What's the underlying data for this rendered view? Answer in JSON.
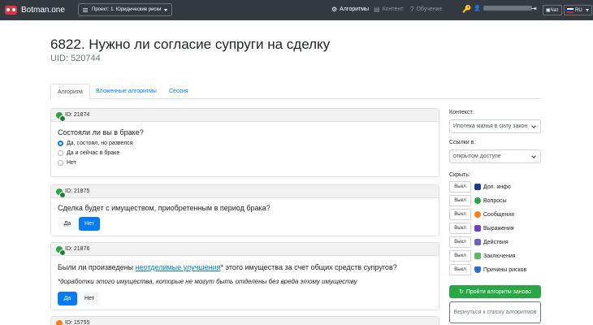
{
  "navbar": {
    "brand": "Botman.one",
    "project": "Проект: 1. Юридические риски",
    "algorithms": "Алгоритмы",
    "content": "Контент",
    "learning": "Обучение",
    "chat": "Чат",
    "lang": "RU"
  },
  "page": {
    "title": "6822. Нужно ли согласие супруги на сделку",
    "uid": "UID: 520744"
  },
  "tabs": [
    "Алгоритм",
    "Вложенные алгоритмы",
    "Сессия"
  ],
  "cards": [
    {
      "id": "ID: 21874",
      "question": "Состояли ли вы в браке?",
      "options": [
        "Да, состоял, но развелся",
        "Да и сейчас в браке",
        "Нет"
      ]
    },
    {
      "id": "ID: 21875",
      "question": "Сделка будет с имуществом, приобретенным в период брака?",
      "buttons": [
        "Да",
        "Нет"
      ]
    },
    {
      "id": "ID: 21876",
      "question_pre": "Были ли произведены ",
      "question_link": "неотделимые улучшения",
      "question_post": "* этого имущества за счет общих средств супругов?",
      "note": "*доработки этого имущества, которые не могут быть отделены без вреда этому имуществу",
      "buttons": [
        "Да",
        "Нет"
      ]
    },
    {
      "id": "ID: 15755"
    }
  ],
  "sidebar": {
    "context_label": "Контекст:",
    "context_value": "Ипотека жилья в силу закон",
    "links_label": "Ссылки в:",
    "links_value": "открытом доступе",
    "hide_label": "Скрыть:",
    "hide_button": "Выкл",
    "hide_items": [
      {
        "label": "Доп. инфо",
        "color": "#1a3f8f"
      },
      {
        "label": "Вопросы",
        "color": "#28a745"
      },
      {
        "label": "Сообщения",
        "color": "#fd7e14"
      },
      {
        "label": "Выражения",
        "color": "#6f42c1"
      },
      {
        "label": "Действия",
        "color": "#6c63c9"
      },
      {
        "label": "Заключения",
        "color": "#5cb85c"
      },
      {
        "label": "Причины рисков",
        "color": "#2b6cd4"
      }
    ],
    "restart": "Пройти алгоритм заново",
    "back": "Вернуться к списку алгоритмов"
  }
}
